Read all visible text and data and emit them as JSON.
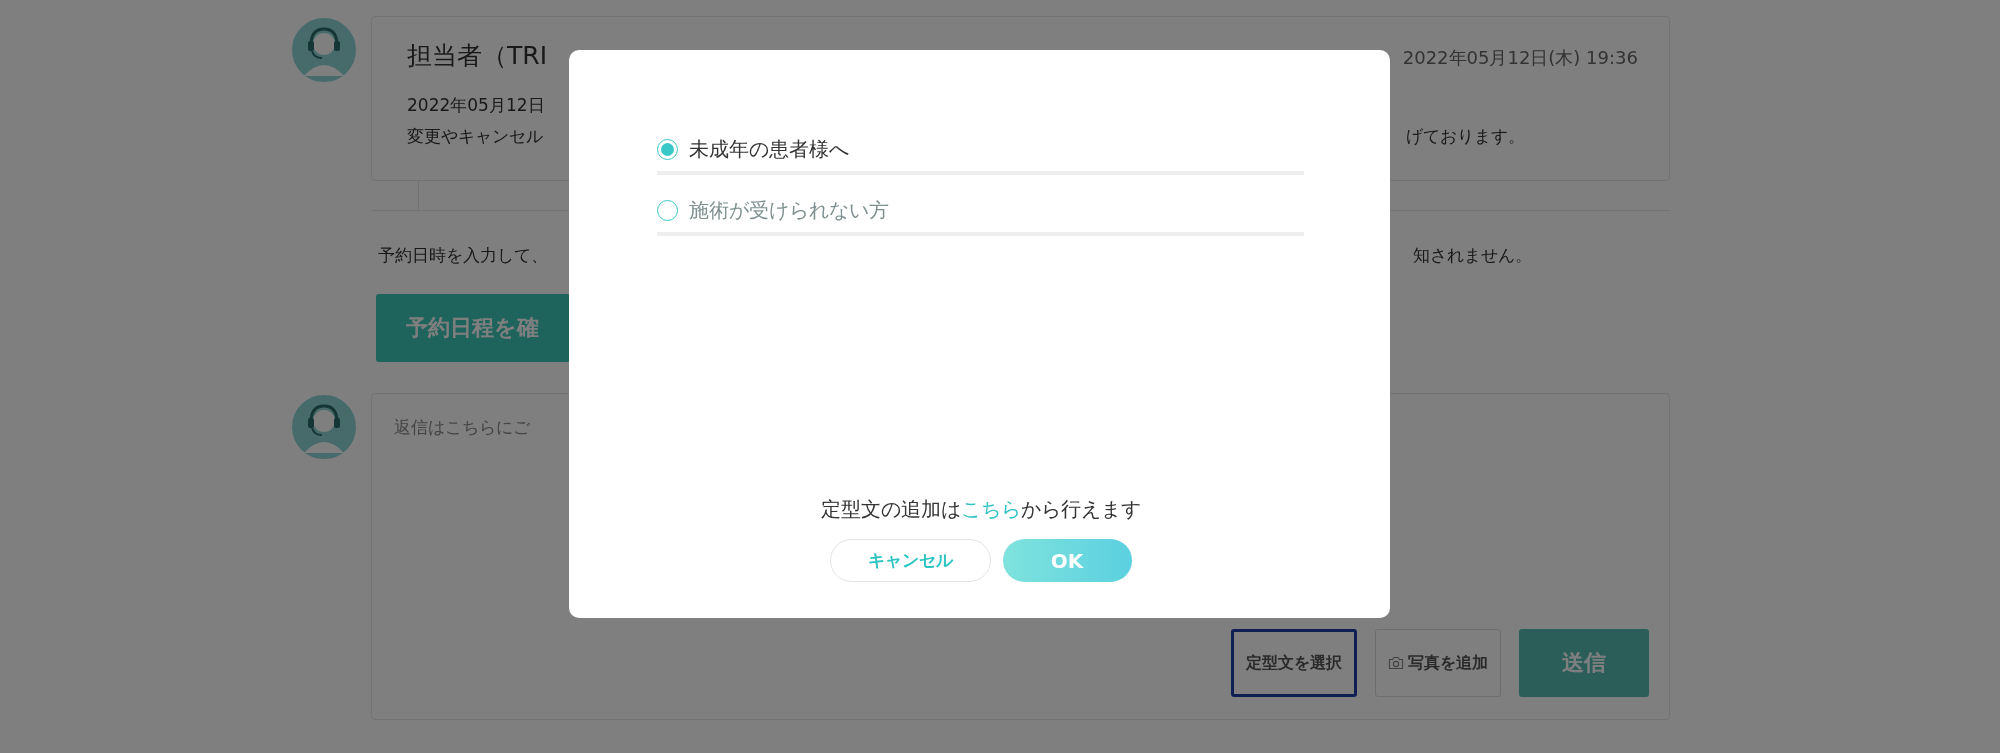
{
  "thread": {
    "message": {
      "sender": "担当者（TRI",
      "timestamp": "2022年05月12日(木) 19:36",
      "lines": [
        {
          "left": "2022年05月12日"
        },
        {
          "left": "変更やキャンセル",
          "right": "げております。"
        }
      ]
    },
    "notice": {
      "left": "予約日時を入力して、",
      "right": "知されません。"
    },
    "confirm_button": "予約日程を確",
    "reply": {
      "placeholder": "返信はこちらにご",
      "buttons": [
        {
          "kind": "template",
          "label": "定型文を選択",
          "focused": true
        },
        {
          "kind": "photo",
          "label": "写真を追加",
          "focused": false
        },
        {
          "kind": "send",
          "label": "送信",
          "focused": false,
          "disabled": true
        }
      ]
    }
  },
  "modal": {
    "options": [
      {
        "label": "未成年の患者様へ",
        "selected": true
      },
      {
        "label": "施術が受けられない方",
        "selected": false
      }
    ],
    "note": {
      "before": "定型文の追加は",
      "link": "こちら",
      "after": "から行えます"
    },
    "buttons": [
      {
        "kind": "cancel",
        "label": "キャンセル"
      },
      {
        "kind": "ok",
        "label": "OK"
      }
    ]
  }
}
